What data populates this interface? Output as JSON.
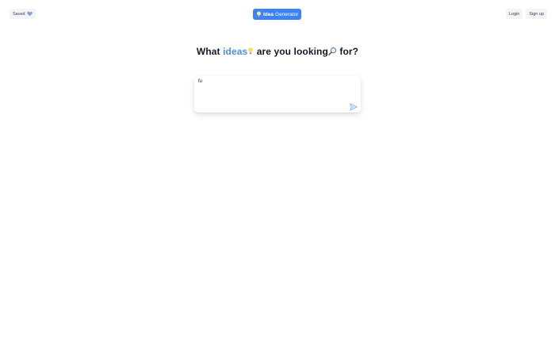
{
  "header": {
    "saved_label": "Saved",
    "brand_bold": "Idea",
    "brand_rest": "Generator",
    "login_label": "Login",
    "signup_label": "Sign up"
  },
  "headline": {
    "part1": "What",
    "accent": "ideas",
    "part2": "are you looking",
    "part3": "for?"
  },
  "prompt": {
    "value": "fu"
  },
  "icons": {
    "saved": "heart-icon",
    "brand": "lightbulb-icon",
    "headline_1": "lightbulb-icon",
    "headline_2": "magnifier-icon",
    "send": "send-icon"
  },
  "colors": {
    "accent": "#4a90e2",
    "brand_bg": "#3b82f6",
    "heart": "#8b9bd3"
  }
}
